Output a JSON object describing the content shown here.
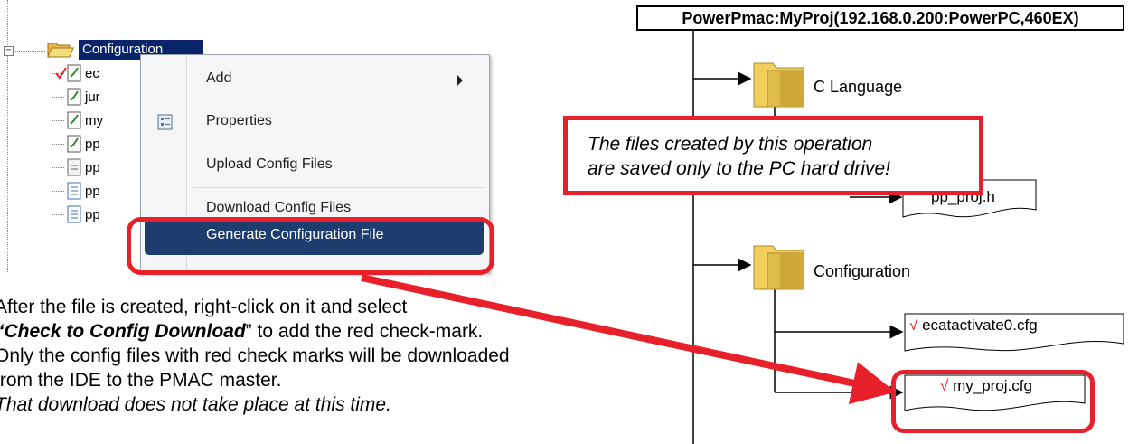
{
  "tree": {
    "root_label": "Configuration",
    "items": [
      {
        "label": "ec",
        "icon": "config-file-icon",
        "checked": true
      },
      {
        "label": "jur",
        "icon": "config-file-icon",
        "checked": false
      },
      {
        "label": "my",
        "icon": "config-file-icon",
        "checked": false
      },
      {
        "label": "pp",
        "icon": "config-file-icon",
        "checked": false
      },
      {
        "label": "pp",
        "icon": "generic-file-icon",
        "checked": false
      },
      {
        "label": "pp",
        "icon": "document-icon",
        "checked": false
      },
      {
        "label": "pp",
        "icon": "document-icon",
        "checked": false
      }
    ]
  },
  "context_menu": {
    "items": [
      {
        "label": "Add",
        "has_submenu": true
      },
      {
        "label": "Properties",
        "icon": "properties-icon"
      },
      {
        "label": "Upload Config Files"
      },
      {
        "label": "Download Config Files"
      },
      {
        "label": "Generate Configuration File",
        "highlighted": true
      }
    ]
  },
  "instruction": {
    "line1": "After the file is created, right-click on it and select",
    "line2_quote_open": "“",
    "line2_strong": "Check to Config Download",
    "line2_rest": "” to add the red check-mark.",
    "line3": "Only the config files with red check marks will be downloaded",
    "line4": "from the IDE to the PMAC master.",
    "line5": "That download does not take place at this time."
  },
  "diagram": {
    "title": "PowerPmac:MyProj(192.168.0.200:PowerPC,460EX)",
    "folders": [
      {
        "label": "C Language"
      },
      {
        "label": "Configuration"
      }
    ],
    "files": [
      {
        "label": "pp_proj.h"
      },
      {
        "check": "√",
        "label": "ecatactivate0.cfg"
      },
      {
        "check": "√",
        "label": "my_proj.cfg"
      }
    ],
    "note": {
      "line1": "The files created by this operation",
      "line2": "are saved only to the PC hard drive!"
    }
  },
  "colors": {
    "highlight_red": "#e8202a",
    "menu_selection": "#1c3d6e",
    "tree_selection": "#0a246a",
    "folder_yellow": "#f0cf5c"
  }
}
